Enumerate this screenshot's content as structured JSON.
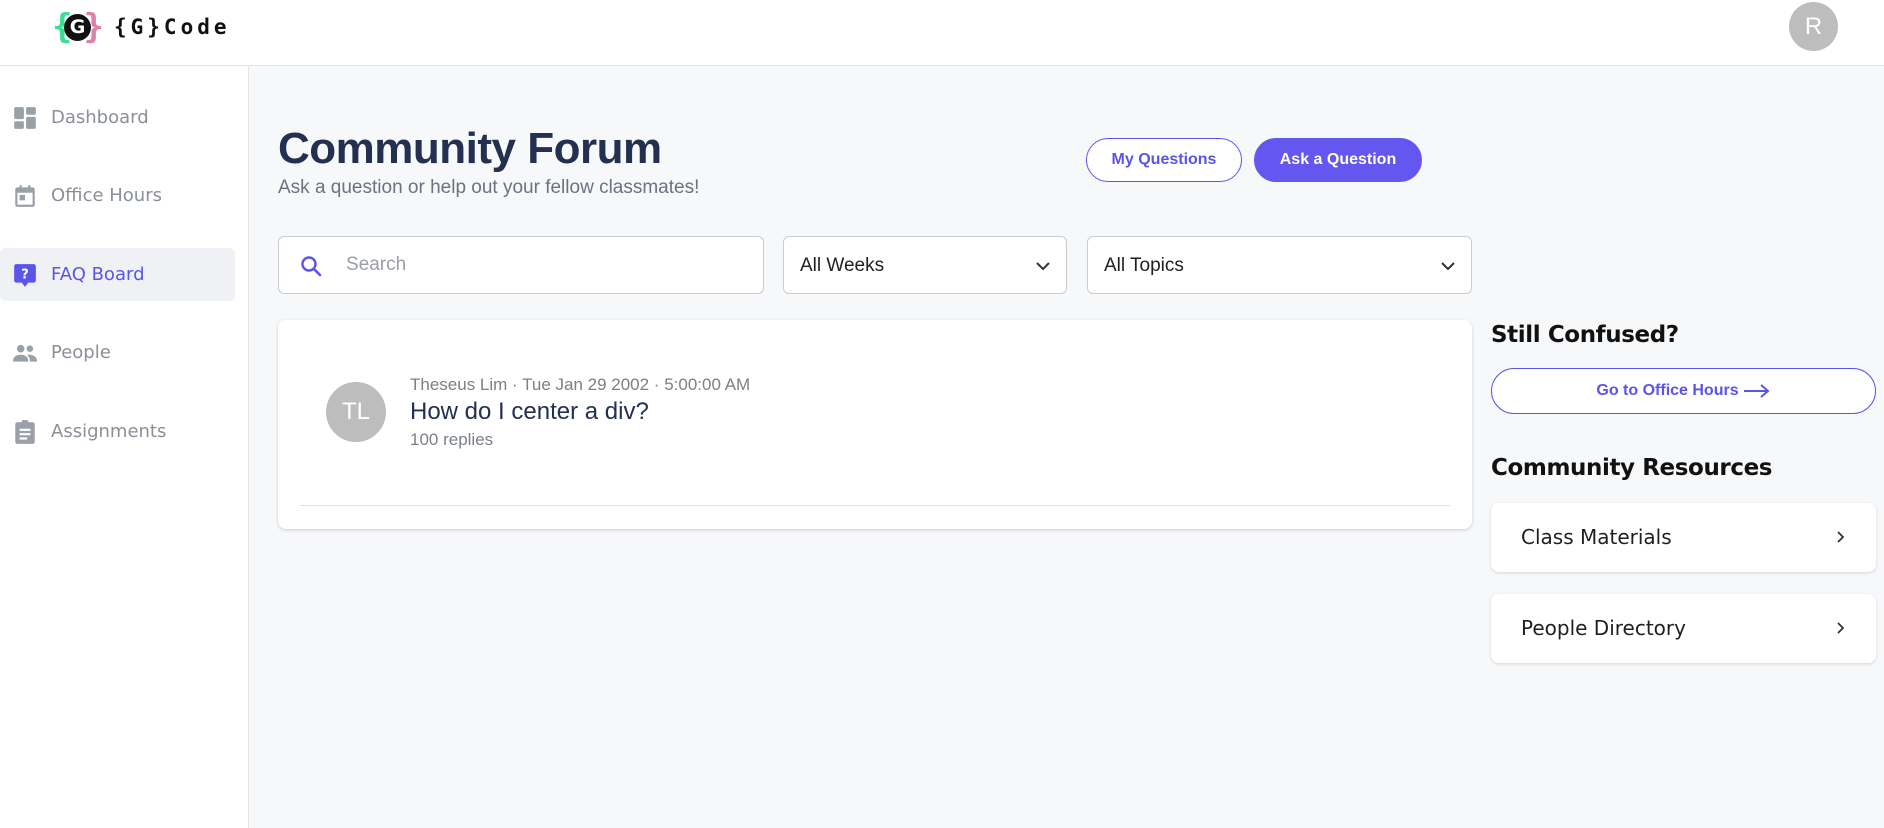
{
  "header": {
    "logo_mark": "G",
    "logo_text": "{G}Code",
    "user_initial": "R"
  },
  "sidebar": {
    "items": [
      {
        "label": "Dashboard",
        "icon": "dashboard-icon",
        "active": false
      },
      {
        "label": "Office Hours",
        "icon": "calendar-icon",
        "active": false
      },
      {
        "label": "FAQ Board",
        "icon": "question-board-icon",
        "active": true
      },
      {
        "label": "People",
        "icon": "people-icon",
        "active": false
      },
      {
        "label": "Assignments",
        "icon": "clipboard-icon",
        "active": false
      }
    ]
  },
  "main": {
    "title": "Community Forum",
    "subtitle": "Ask a question or help out your fellow classmates!",
    "my_questions_label": "My Questions",
    "ask_question_label": "Ask a Question",
    "search": {
      "placeholder": "Search",
      "value": ""
    },
    "weeks_filter": "All Weeks",
    "topics_filter": "All Topics",
    "posts": [
      {
        "initials": "TL",
        "meta": "Theseus Lim · Tue Jan 29 2002 · 5:00:00 AM",
        "title": "How do I center a div?",
        "replies": "100 replies"
      }
    ]
  },
  "right": {
    "confused_heading": "Still Confused?",
    "office_hours_button": "Go to Office Hours",
    "resources_heading": "Community Resources",
    "resources": [
      {
        "label": "Class Materials"
      },
      {
        "label": "People Directory"
      }
    ]
  },
  "colors": {
    "accent": "#6357ef",
    "heading": "#23304f",
    "avatar_gray": "#bdbdbd",
    "logo_green": "#3ddc97",
    "logo_pink": "#e07fa8"
  }
}
